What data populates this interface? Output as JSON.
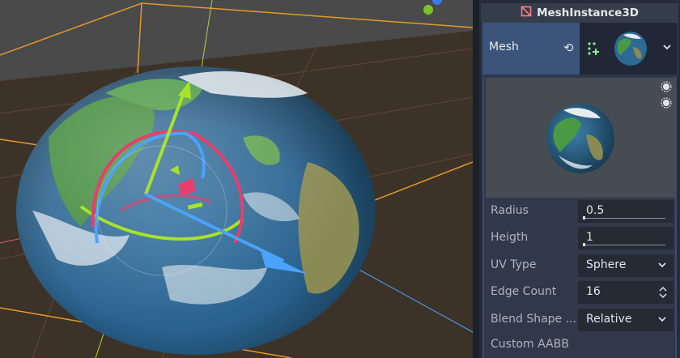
{
  "viewport": {
    "label": "3D viewport",
    "ground_color": "#403529",
    "sky_color": "#4a4a4a",
    "gizmo_colors": {
      "x": "#e83e6c",
      "y": "#a8e22b",
      "z": "#4aa3ff"
    }
  },
  "inspector": {
    "header": {
      "icon": "mesh-instance-icon",
      "title": "MeshInstance3D"
    },
    "mesh_property": {
      "label": "Mesh",
      "revert_icon": "revert-icon",
      "drag_icon": "drag-icon",
      "thumbnail": "globe-thumbnail",
      "dropdown_icon": "chevron-down-icon"
    },
    "preview": {
      "background": "#474c53",
      "light_icon": "light-toggle-icon",
      "light2_icon": "light-toggle-icon"
    },
    "properties": [
      {
        "key": "radius",
        "label": "Radius",
        "value": "0.5",
        "control": "slider"
      },
      {
        "key": "height",
        "label": "Heigth",
        "value": "1",
        "control": "slider"
      },
      {
        "key": "uv_type",
        "label": "UV Type",
        "value": "Sphere",
        "control": "select"
      },
      {
        "key": "edge_count",
        "label": "Edge Count",
        "value": "16",
        "control": "spin"
      },
      {
        "key": "blend_shape",
        "label": "Blend Shape ...",
        "value": "Relative",
        "control": "select"
      },
      {
        "key": "custom_aabb",
        "label": "Custom AABB",
        "value": "",
        "control": "group"
      }
    ]
  }
}
